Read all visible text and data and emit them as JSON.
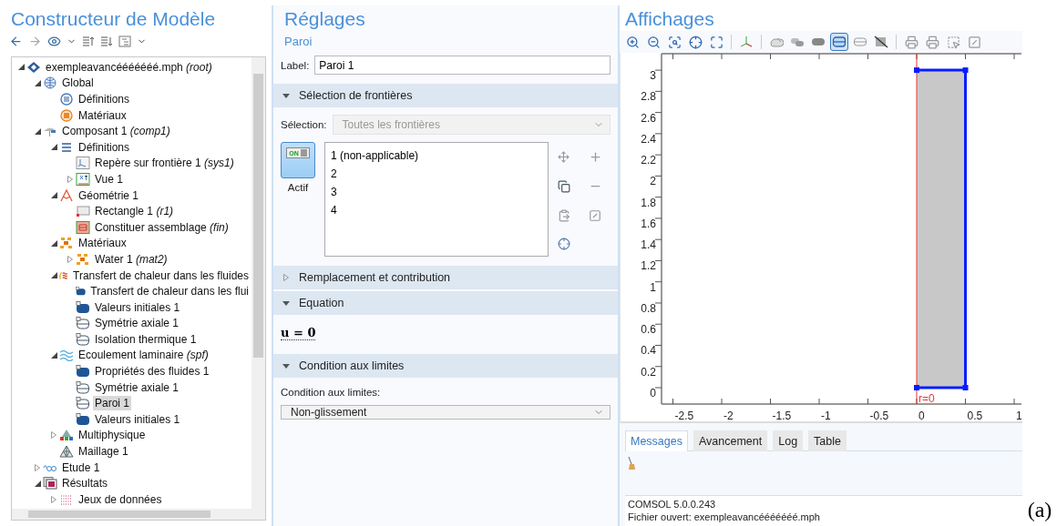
{
  "model_builder": {
    "title": "Constructeur de Modèle",
    "tree": [
      {
        "label": "exempleavancééééééé.mph *(root)*",
        "kind": "file",
        "expanded": true,
        "selected": false,
        "children": [
          {
            "label": "Global",
            "kind": "globe",
            "expanded": true,
            "selected": false,
            "children": [
              {
                "label": "Définitions",
                "kind": "defs-circle",
                "selected": false
              },
              {
                "label": "Matériaux",
                "kind": "mat-circle",
                "selected": false
              }
            ]
          },
          {
            "label": "Composant 1 *(comp1)*",
            "kind": "component",
            "expanded": true,
            "selected": false,
            "children": [
              {
                "label": "Définitions",
                "kind": "defs",
                "expanded": true,
                "selected": false,
                "children": [
                  {
                    "label": "Repère sur frontière 1 *(sys1)*",
                    "kind": "frame",
                    "selected": false
                  },
                  {
                    "label": "Vue 1",
                    "kind": "view",
                    "expanded": false,
                    "selected": false
                  }
                ]
              },
              {
                "label": "Géométrie 1",
                "kind": "geometry",
                "expanded": true,
                "selected": false,
                "children": [
                  {
                    "label": "Rectangle 1 *(r1)*",
                    "kind": "rectangle",
                    "selected": false
                  },
                  {
                    "label": "Constituer assemblage *(fin)*",
                    "kind": "union",
                    "selected": false
                  }
                ]
              },
              {
                "label": "Matériaux",
                "kind": "materials",
                "expanded": true,
                "selected": false,
                "children": [
                  {
                    "label": "Water 1 *(mat2)*",
                    "kind": "materials",
                    "expanded": false,
                    "selected": false
                  }
                ]
              },
              {
                "label": "Transfert de chaleur dans les fluides",
                "kind": "heat",
                "expanded": true,
                "selected": false,
                "children": [
                  {
                    "label": "Transfert de chaleur dans les flui",
                    "kind": "node-filled",
                    "selected": false
                  },
                  {
                    "label": "Valeurs initiales 1",
                    "kind": "node-filled",
                    "selected": false
                  },
                  {
                    "label": "Symétrie axiale 1",
                    "kind": "node-outline",
                    "selected": false
                  },
                  {
                    "label": "Isolation thermique 1",
                    "kind": "node-outline",
                    "selected": false
                  }
                ]
              },
              {
                "label": "Ecoulement laminaire *(spf)*",
                "kind": "flow",
                "expanded": true,
                "selected": false,
                "children": [
                  {
                    "label": "Propriétés des fluides 1",
                    "kind": "node-filled",
                    "selected": false
                  },
                  {
                    "label": "Symétrie axiale 1",
                    "kind": "node-outline",
                    "selected": false
                  },
                  {
                    "label": "Paroi 1",
                    "kind": "node-outline",
                    "selected": true
                  },
                  {
                    "label": "Valeurs initiales 1",
                    "kind": "node-filled",
                    "selected": false
                  }
                ]
              },
              {
                "label": "Multiphysique",
                "kind": "multiphysics",
                "expanded": false,
                "selected": false
              },
              {
                "label": "Maillage 1",
                "kind": "mesh",
                "selected": false
              }
            ]
          },
          {
            "label": "Etude 1",
            "kind": "study",
            "expanded": false,
            "selected": false
          },
          {
            "label": "Résultats",
            "kind": "results",
            "expanded": true,
            "selected": false,
            "children": [
              {
                "label": "Jeux de données",
                "kind": "datasets",
                "expanded": false,
                "selected": false
              }
            ]
          }
        ]
      }
    ]
  },
  "settings": {
    "title": "Réglages",
    "subtitle": "Paroi",
    "label_field": {
      "label": "Label:",
      "value": "Paroi 1"
    },
    "sections": [
      {
        "kind": "selection",
        "title": "Sélection de frontières",
        "expanded": true,
        "selection_label": "Sélection:",
        "selection_value": "Toutes les frontières",
        "toggle_text": "ON",
        "toggle_on": true,
        "toggle_label": "Actif",
        "items": [
          "1 (non-applicable)",
          "2",
          "3",
          "4"
        ]
      },
      {
        "title": "Remplacement et contribution",
        "expanded": false
      },
      {
        "kind": "equation",
        "title": "Equation",
        "expanded": true,
        "equation": "u = 0"
      },
      {
        "kind": "dropdown",
        "title": "Condition aux limites",
        "expanded": true,
        "field_label": "Condition aux limites:",
        "value": "Non-glissement"
      }
    ]
  },
  "graphics": {
    "title": "Affichages",
    "toolbar_groups": [
      [
        {
          "kind": "zoom-in",
          "selected": false
        },
        {
          "kind": "zoom-out",
          "selected": false
        },
        {
          "kind": "zoom-box",
          "selected": false
        },
        {
          "kind": "center",
          "selected": false
        },
        {
          "kind": "extents",
          "selected": false
        }
      ],
      [
        {
          "kind": "axes",
          "selected": false
        }
      ],
      [
        {
          "kind": "render-a",
          "selected": false
        },
        {
          "kind": "render-b",
          "selected": false
        },
        {
          "kind": "render-c",
          "selected": false
        },
        {
          "kind": "render-d",
          "selected": true
        },
        {
          "kind": "render-e",
          "selected": false
        },
        {
          "kind": "render-f",
          "selected": false
        }
      ],
      [
        {
          "kind": "print-a",
          "selected": false
        },
        {
          "kind": "print-b",
          "selected": false
        },
        {
          "kind": "select-a",
          "selected": false
        },
        {
          "kind": "select-b",
          "selected": false
        }
      ]
    ],
    "yticks": [
      "3",
      "2.8",
      "2.6",
      "2.4",
      "2.2",
      "2",
      "1.8",
      "1.6",
      "1.4",
      "1.2",
      "1",
      "0.8",
      "0.6",
      "0.4",
      "0.2",
      "0"
    ],
    "xticks": [
      "-2.5",
      "-2",
      "-1.5",
      "-1",
      "-0.5",
      "0",
      "0.5",
      "1"
    ],
    "axis_label": "r=0"
  },
  "messages": {
    "tabs": [
      {
        "label": "Messages",
        "selected": true
      },
      {
        "label": "Avancement",
        "selected": false
      },
      {
        "label": "Log",
        "selected": false
      },
      {
        "label": "Table",
        "selected": false
      }
    ],
    "lines": [
      "COMSOL 5.0.0.243",
      "Fichier ouvert: exempleavancééééééé.mph"
    ]
  },
  "caption": "(a)"
}
